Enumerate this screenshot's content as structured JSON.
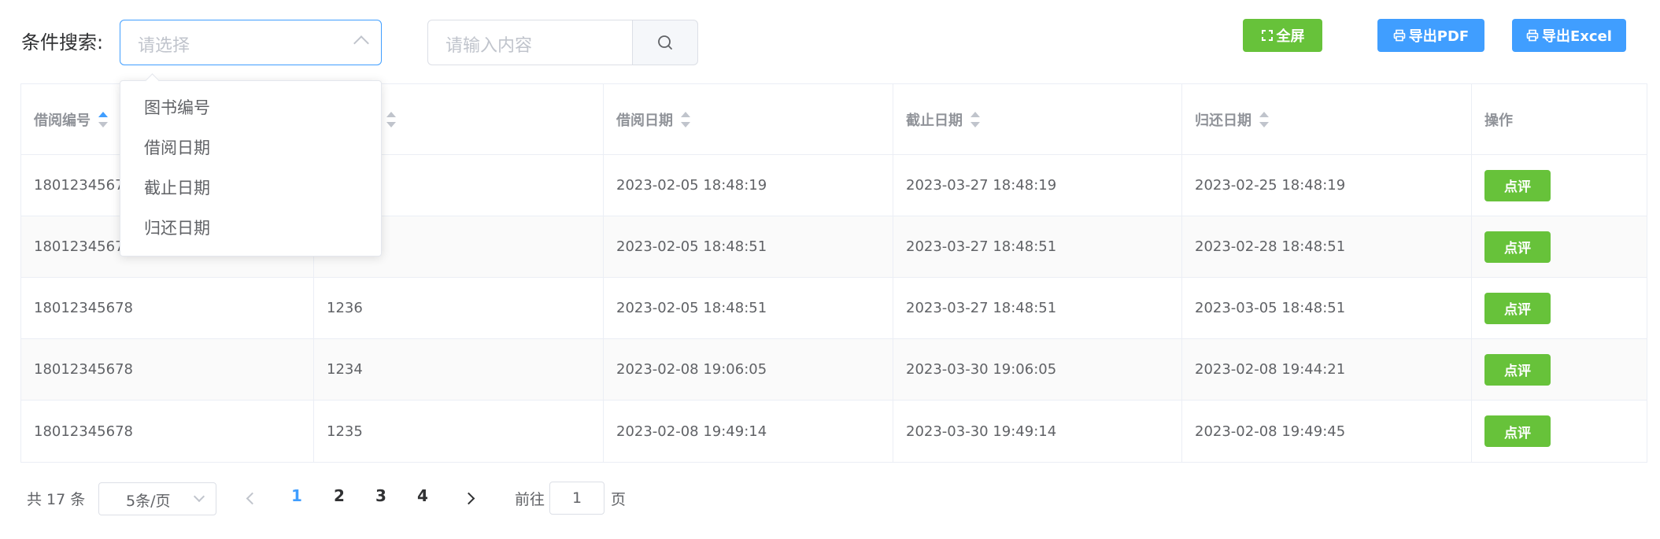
{
  "toolbar": {
    "search_label": "条件搜索:",
    "select_placeholder": "请选择",
    "keyword_placeholder": "请输入内容",
    "fullscreen_label": "全屏",
    "export_pdf_label": "导出PDF",
    "export_excel_label": "导出Excel"
  },
  "dropdown": {
    "options": [
      "图书编号",
      "借阅日期",
      "截止日期",
      "归还日期"
    ]
  },
  "table": {
    "headers": [
      "借阅编号",
      "",
      "借阅日期",
      "截止日期",
      "归还日期",
      "操作"
    ],
    "action_label": "点评",
    "rows": [
      [
        "18012345678",
        "",
        "2023-02-05 18:48:19",
        "2023-03-27 18:48:19",
        "2023-02-25 18:48:19"
      ],
      [
        "18012345678",
        "",
        "2023-02-05 18:48:51",
        "2023-03-27 18:48:51",
        "2023-02-28 18:48:51"
      ],
      [
        "18012345678",
        "1236",
        "2023-02-05 18:48:51",
        "2023-03-27 18:48:51",
        "2023-03-05 18:48:51"
      ],
      [
        "18012345678",
        "1234",
        "2023-02-08 19:06:05",
        "2023-03-30 19:06:05",
        "2023-02-08 19:44:21"
      ],
      [
        "18012345678",
        "1235",
        "2023-02-08 19:49:14",
        "2023-03-30 19:49:14",
        "2023-02-08 19:49:45"
      ]
    ]
  },
  "pagination": {
    "total_text": "共 17 条",
    "page_size": "5条/页",
    "pages": [
      "1",
      "2",
      "3",
      "4"
    ],
    "current_page": "1",
    "goto_label": "前往",
    "goto_value": "1",
    "goto_suffix": "页"
  },
  "colors": {
    "primary": "#409eff",
    "success": "#67c23a"
  }
}
